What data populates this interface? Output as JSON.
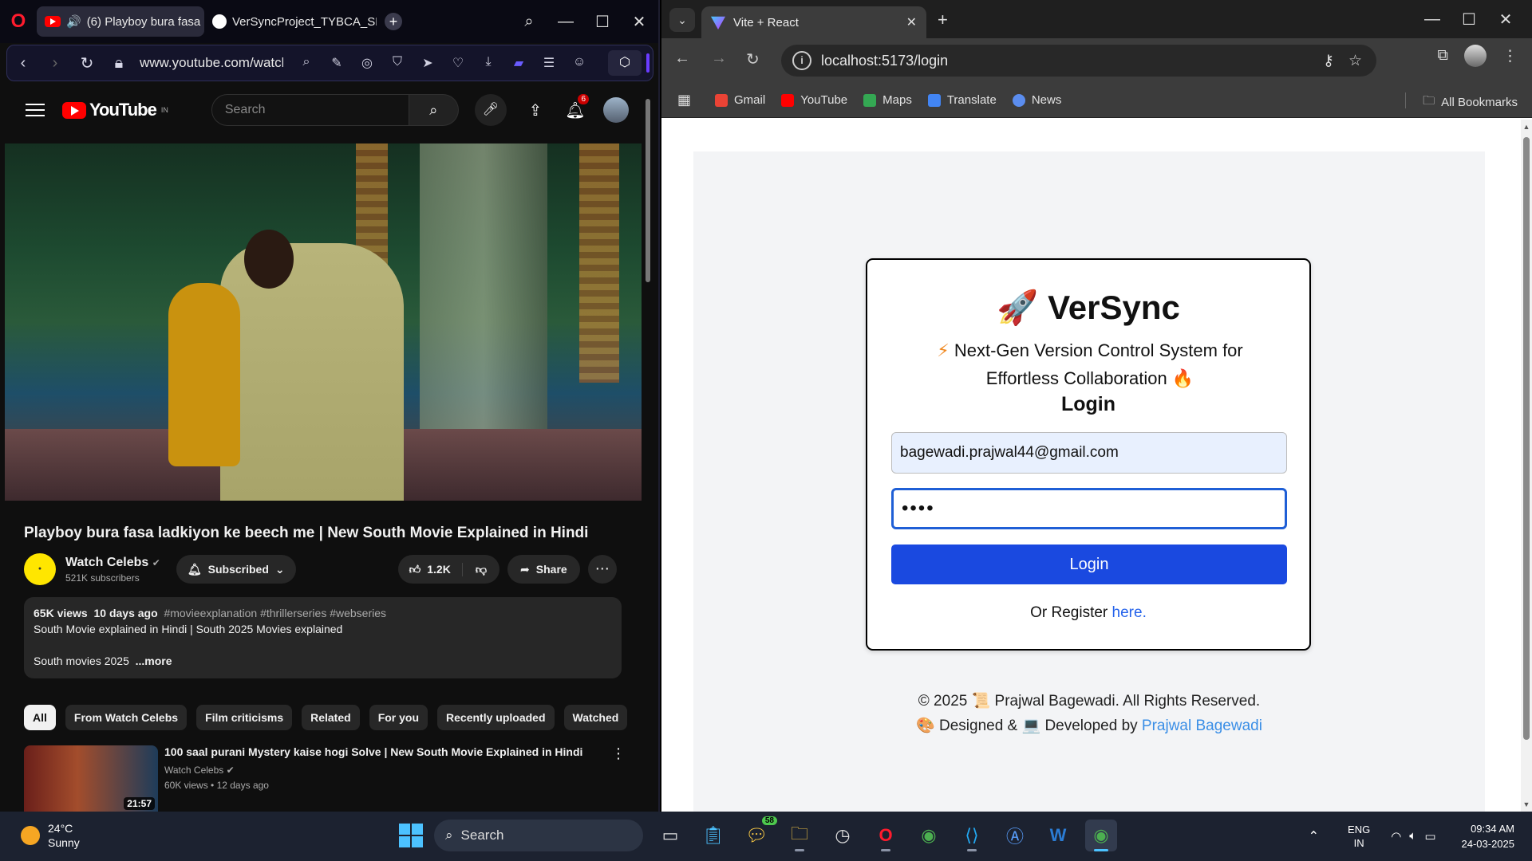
{
  "opera": {
    "tabs": [
      {
        "label": "(6) Playboy bura fasa l"
      },
      {
        "label": "VerSyncProject_TYBCA_SE"
      }
    ],
    "url": "www.youtube.com/watcl"
  },
  "youtube": {
    "logo_text": "YouTube",
    "region": "IN",
    "search_placeholder": "Search",
    "notification_count": "6",
    "video_title": "Playboy bura fasa ladkiyon ke beech me | New South Movie Explained in Hindi",
    "channel_name": "Watch Celebs",
    "subscribers": "521K subscribers",
    "subscribe_label": "Subscribed",
    "likes": "1.2K",
    "share_label": "Share",
    "description": {
      "views": "65K views",
      "date": "10 days ago",
      "tags": "#movieexplanation #thrillerseries #webseries",
      "line2": "South Movie explained in Hindi | South 2025 Movies explained",
      "line3": "South movies 2025",
      "more": "...more"
    },
    "chips": [
      "All",
      "From Watch Celebs",
      "Film criticisms",
      "Related",
      "For you",
      "Recently uploaded",
      "Watched"
    ],
    "recommended": {
      "title": "100 saal purani Mystery kaise hogi Solve | New South Movie Explained in Hindi",
      "channel": "Watch Celebs",
      "views": "60K views",
      "age": "12 days ago",
      "duration": "21:57"
    }
  },
  "chrome": {
    "tab_title": "Vite + React",
    "url": "localhost:5173/login",
    "bookmarks": [
      "Gmail",
      "YouTube",
      "Maps",
      "Translate",
      "News"
    ],
    "all_bookmarks": "All Bookmarks"
  },
  "login_page": {
    "brand": "VerSync",
    "tagline": "Next-Gen Version Control System for Effortless Collaboration",
    "heading": "Login",
    "email_value": "bagewadi.prajwal44@gmail.com",
    "password_mask": "••••",
    "button_label": "Login",
    "register_prefix": "Or Register",
    "register_link": "here.",
    "footer_copyright": "© 2025 📜 Prajwal Bagewadi. All Rights Reserved.",
    "footer_prefix": "Designed & 💻 Developed by",
    "footer_author": "Prajwal Bagewadi"
  },
  "taskbar": {
    "temperature": "24°C",
    "condition": "Sunny",
    "search_label": "Search",
    "notification_badge": "58",
    "lang_line1": "ENG",
    "lang_line2": "IN",
    "time": "09:34 AM",
    "date": "24-03-2025"
  }
}
